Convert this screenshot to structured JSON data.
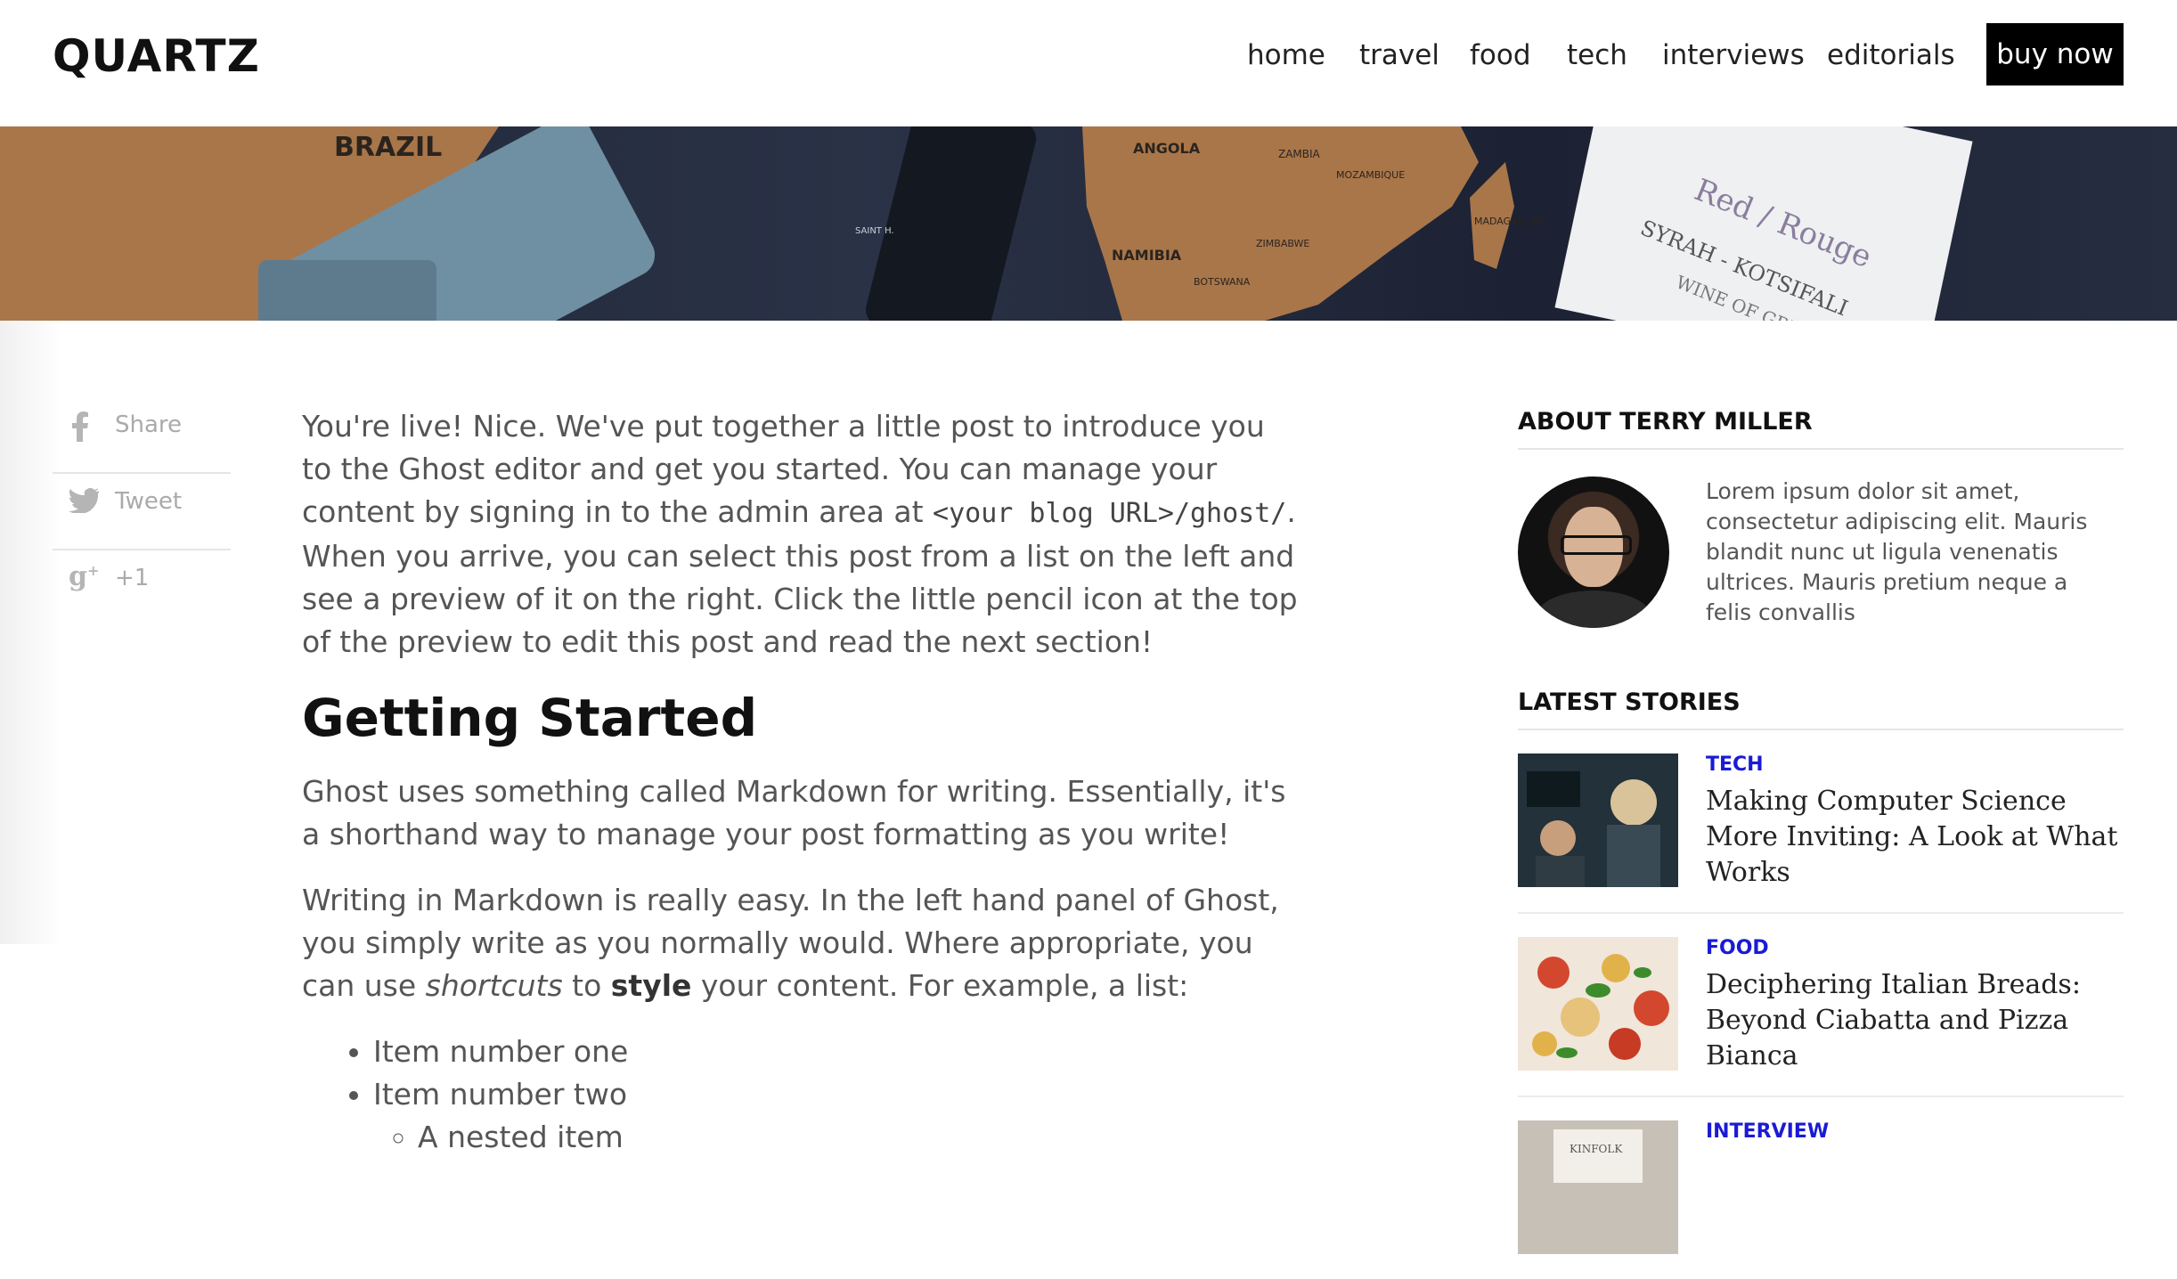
{
  "site": {
    "logo": "QUARTZ"
  },
  "nav": {
    "items": [
      "home",
      "travel",
      "food",
      "tech",
      "interviews",
      "editorials"
    ],
    "buy_label": "buy now"
  },
  "hero": {
    "map_labels": [
      "BRAZIL",
      "ANGOLA",
      "ZAMBIA",
      "NAMIBIA",
      "BOTSWANA",
      "ZIMBABWE",
      "MOZAMBIQUE",
      "MADAGASCAR",
      "SAINT H."
    ],
    "bottle_text": [
      "Red / Rouge",
      "SYRAH - KOTSIFALI",
      "WINE OF GREECE"
    ]
  },
  "share": {
    "items": [
      {
        "icon": "facebook-icon",
        "label": "Share"
      },
      {
        "icon": "twitter-icon",
        "label": "Tweet"
      },
      {
        "icon": "google-plus-icon",
        "label": "+1"
      }
    ]
  },
  "article": {
    "intro_before_code": "You're live! Nice. We've put together a little post to introduce you to the Ghost editor and get you started. You can manage your content by signing in to the admin area at ",
    "intro_code": "<your blog URL>/ghost/",
    "intro_after_code": ". When you arrive, you can select this post from a list on the left and see a preview of it on the right. Click the little pencil icon at the top of the preview to edit this post and read the next section!",
    "heading": "Getting Started",
    "para2": "Ghost uses something called Markdown for writing. Essentially, it's a shorthand way to manage your post formatting as you write!",
    "para3_before": "Writing in Markdown is really easy. In the left hand panel of Ghost, you simply write as you normally would. Where appropriate, you can use ",
    "para3_em": "shortcuts",
    "para3_mid": " to ",
    "para3_strong": "style",
    "para3_after": " your content. For example, a list:",
    "list": [
      "Item number one",
      "Item number two"
    ],
    "nested": "A nested item"
  },
  "sidebar": {
    "about_heading": "ABOUT TERRY MILLER",
    "about_text": "Lorem ipsum dolor sit amet, consectetur adipiscing elit. Mauris blandit nunc ut ligula venenatis ultrices. Mauris pretium neque a felis convallis",
    "latest_heading": "LATEST STORIES",
    "stories": [
      {
        "category": "TECH",
        "title": "Making Computer Science More Inviting: A Look at What Works"
      },
      {
        "category": "FOOD",
        "title": "Deciphering Italian Breads: Beyond Ciabatta and Pizza Bianca"
      },
      {
        "category": "INTERVIEW",
        "title": ""
      }
    ],
    "thumb3_text": "KINFOLK"
  },
  "colors": {
    "category": "#1a1ad6",
    "buy_bg": "#000000",
    "map_land": "#b07b4a"
  }
}
